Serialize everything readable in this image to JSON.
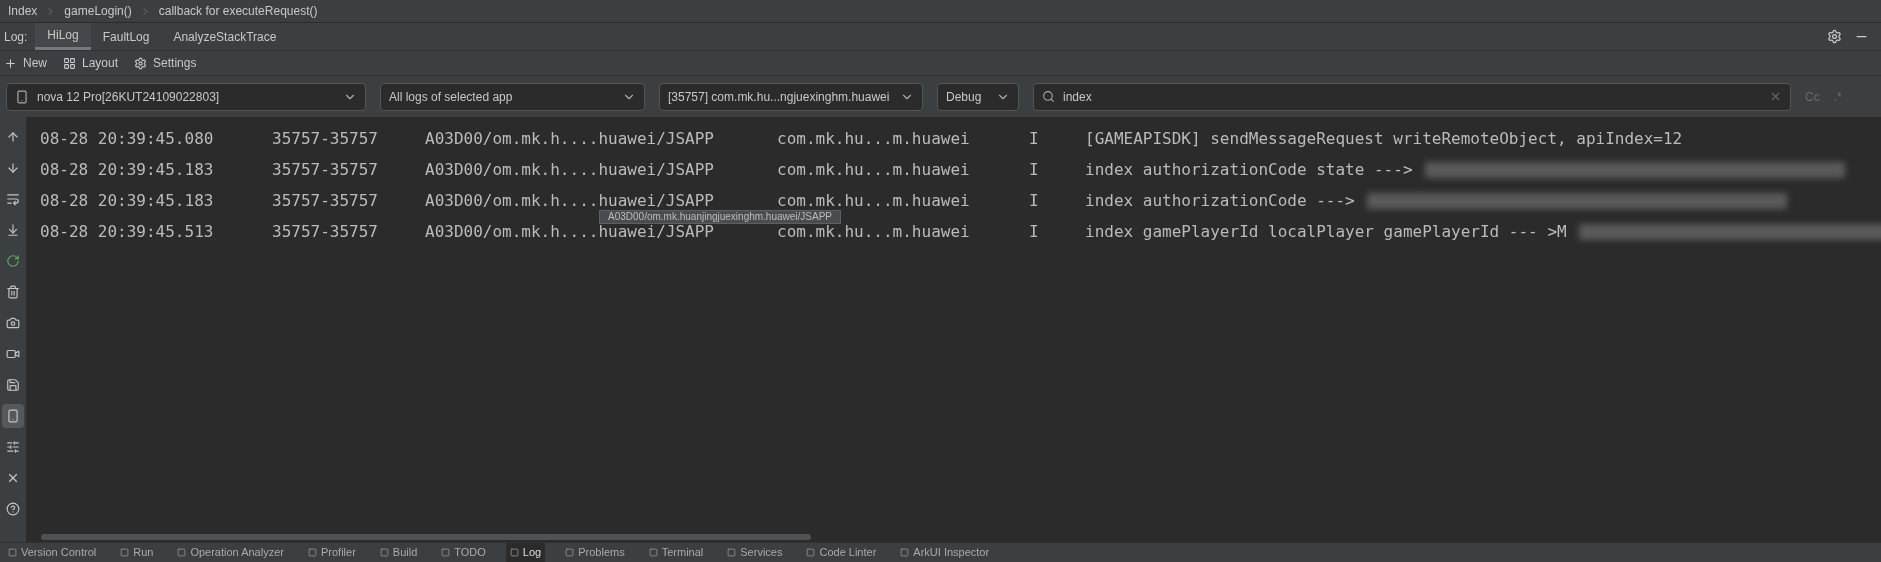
{
  "breadcrumb": [
    "Index",
    "gameLogin()",
    "callback for executeRequest()"
  ],
  "log_label": "Log:",
  "log_tabs": [
    {
      "label": "HiLog",
      "selected": true
    },
    {
      "label": "FaultLog",
      "selected": false
    },
    {
      "label": "AnalyzeStackTrace",
      "selected": false
    }
  ],
  "toolbar": [
    {
      "kind": "plus",
      "label": "New"
    },
    {
      "kind": "grid",
      "label": "Layout"
    },
    {
      "kind": "gear",
      "label": "Settings"
    }
  ],
  "filters": {
    "device": "nova 12 Pro[26KUT24109022803]",
    "scope": "All logs of selected app",
    "process": "[35757] com.mk.hu...ngjuexinghm.huawei",
    "level": "Debug",
    "search": {
      "value": "index"
    },
    "match_case": "Cc",
    "regex": ".*"
  },
  "side_tools": [
    {
      "kind": "up",
      "selected": false
    },
    {
      "kind": "down",
      "selected": false
    },
    {
      "kind": "wrap",
      "selected": false
    },
    {
      "kind": "scroll-end",
      "selected": false
    },
    {
      "kind": "restart",
      "selected": false
    },
    {
      "kind": "trash",
      "selected": false
    },
    {
      "kind": "camera",
      "selected": false
    },
    {
      "kind": "video",
      "selected": false
    },
    {
      "kind": "save",
      "selected": false
    },
    {
      "kind": "phone",
      "selected": true
    },
    {
      "kind": "sliders",
      "selected": false
    },
    {
      "kind": "close",
      "selected": false
    },
    {
      "kind": "help",
      "selected": false
    }
  ],
  "log_rows": [
    {
      "time": "08-28 20:39:45.080",
      "pid": "35757-35757",
      "tag": "A03D00/om.mk.h....huawei/JSAPP",
      "package": "com.mk.hu...m.huawei",
      "level": "I",
      "message": "[GAMEAPISDK] sendMessageRequest writeRemoteObject, apiIndex=12",
      "redacted": false
    },
    {
      "time": "08-28 20:39:45.183",
      "pid": "35757-35757",
      "tag": "A03D00/om.mk.h....huawei/JSAPP",
      "package": "com.mk.hu...m.huawei",
      "level": "I",
      "message": "index  authorizationCode  state   --->",
      "redacted": true
    },
    {
      "time": "08-28 20:39:45.183",
      "pid": "35757-35757",
      "tag": "A03D00/om.mk.h....huawei/JSAPP",
      "package": "com.mk.hu...m.huawei",
      "level": "I",
      "message": "index  authorizationCode  --->",
      "redacted": true
    },
    {
      "time": "08-28 20:39:45.513",
      "pid": "35757-35757",
      "tag": "A03D00/om.mk.h....huawei/JSAPP",
      "package": "com.mk.hu...m.huawei",
      "level": "I",
      "message": "index gamePlayerId  localPlayer gamePlayerId  --- >M",
      "redacted": true
    }
  ],
  "tooltip": "A03D00/om.mk.huanjingjuexinghm.huawei/JSAPP",
  "bottom_tabs": [
    {
      "label": "Version Control",
      "selected": false
    },
    {
      "label": "Run",
      "selected": false
    },
    {
      "label": "Operation Analyzer",
      "selected": false
    },
    {
      "label": "Profiler",
      "selected": false
    },
    {
      "label": "Build",
      "selected": false
    },
    {
      "label": "TODO",
      "selected": false
    },
    {
      "label": "Log",
      "selected": true
    },
    {
      "label": "Problems",
      "selected": false
    },
    {
      "label": "Terminal",
      "selected": false
    },
    {
      "label": "Services",
      "selected": false
    },
    {
      "label": "Code Linter",
      "selected": false
    },
    {
      "label": "ArkUI Inspector",
      "selected": false
    }
  ]
}
